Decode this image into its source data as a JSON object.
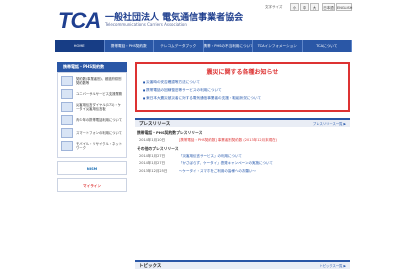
{
  "header": {
    "logo": "TCA",
    "org_name": "一般社団法人 電気通信事業者協会",
    "org_sub": "Telecommunications Carriers Association",
    "font_size_label": "文字サイズ",
    "font_sizes": [
      "小",
      "中",
      "大"
    ],
    "lang_ja": "日本語",
    "lang_en": "ENGLISH"
  },
  "nav": {
    "items": [
      "HOME",
      "携帯電話・PHS契約数",
      "テレコムデータブック",
      "携帯・PHSの不当利用について",
      "TCAインフォメーション",
      "TCAについて"
    ]
  },
  "sidebar": {
    "heading": "携帯電話・PHS契約数",
    "rows": [
      {
        "text": "契約数(事業者別)、都道府県別契約数等"
      },
      {
        "text": "ユニバーサルサービス支援業務"
      },
      {
        "text": "災害用伝言ダイヤル(171)・ケータイ災害用伝言板"
      },
      {
        "text": "青少年の携帯電話利用について"
      },
      {
        "text": "スマートフォンの利用について"
      },
      {
        "text": "モバイル・リサイクル・ネットワーク"
      }
    ],
    "banners": [
      {
        "label": "NISM",
        "color": "#1b6fb5"
      },
      {
        "label": "マイライン",
        "color": "#d33"
      }
    ]
  },
  "notice": {
    "title": "震災に関する各種お知らせ",
    "links": [
      "災害時の安否確認等方法について",
      "携帯電話の回線復旧等サービスの利用について",
      "東日本大震災被災者に対する電気通信事業者の支援・取組状況について"
    ]
  },
  "press": {
    "title": "プレスリリース",
    "more": "プレスリリース一覧 ▶",
    "groups": [
      {
        "heading": "携帯電話・PHS契約数プレスリリース",
        "items": [
          {
            "date": "2014年1月10日",
            "text": "[携帯電話・PHS契約数] 事業者別契約数 (2013年12月末現在)",
            "red": true
          }
        ]
      },
      {
        "heading": "その他のプレスリリース",
        "items": [
          {
            "date": "2014年1月27日",
            "text": "「災害用伝言サービス」の利用について",
            "red": false
          },
          {
            "date": "2014年1月27日",
            "text": "「かさばらず、ケータイ」啓発キャンペーンの実施について",
            "red": false
          },
          {
            "date": "2013年12月25日",
            "text": "〜ケータイ・スマホをご利用の皆様へのお願い〜",
            "red": false
          }
        ]
      }
    ]
  },
  "topics": {
    "title": "トピックス",
    "more": "トピックス一覧 ▶"
  }
}
